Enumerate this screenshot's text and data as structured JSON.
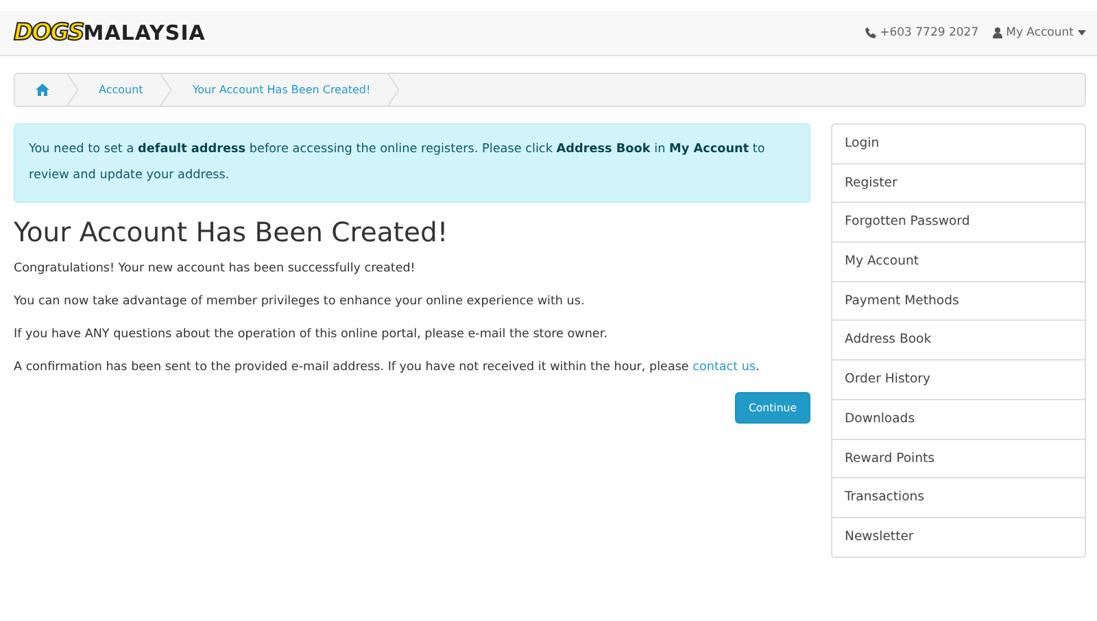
{
  "header": {
    "logo": {
      "part_1": "DOGS",
      "part_2": "MALAYSIA"
    },
    "phone": "+603 7729 2027",
    "account_menu": "My Account"
  },
  "breadcrumb": [
    "Account",
    "Your Account Has Been Created!"
  ],
  "alert": "You need to set a **default address** before accessing the online registers. Please click **Address Book** in **My Account** to review and update your address.",
  "title": "Your Account Has Been Created!",
  "paragraphs": [
    {
      "text": "Congratulations! Your new account has been successfully created!"
    },
    {
      "text": "You can now take advantage of member privileges to enhance your online experience with us."
    },
    {
      "text": "If you have ANY questions about the operation of this online portal, please e-mail the store owner."
    },
    {
      "text": "A confirmation has been sent to the provided e-mail address. If you have not received it within the hour, please",
      "link": "contact us",
      "after": "."
    }
  ],
  "continue_button": "Continue",
  "sidebar": [
    "Login",
    "Register",
    "Forgotten Password",
    "My Account",
    "Payment Methods",
    "Address Book",
    "Order History",
    "Downloads",
    "Reward Points",
    "Transactions",
    "Newsletter"
  ]
}
